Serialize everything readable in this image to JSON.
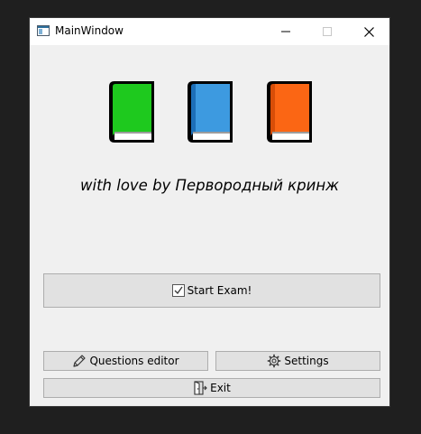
{
  "window": {
    "title": "MainWindow",
    "controls": [
      "minimize-icon",
      "maximize-icon",
      "close-icon"
    ]
  },
  "header": {
    "books": [
      {
        "icon": "book-icon",
        "color": "#1ec91e"
      },
      {
        "icon": "book-icon",
        "color": "#3d9ae0"
      },
      {
        "icon": "book-icon",
        "color": "#fb6614"
      }
    ],
    "tagline": "with love by Первородный кринж"
  },
  "buttons": {
    "start": {
      "label": "Start Exam!",
      "icon": "checkbox-icon"
    },
    "questions_editor": {
      "label": "Questions editor",
      "icon": "pencil-icon"
    },
    "settings": {
      "label": "Settings",
      "icon": "gear-icon"
    },
    "exit": {
      "label": "Exit",
      "icon": "exit-door-icon"
    }
  }
}
